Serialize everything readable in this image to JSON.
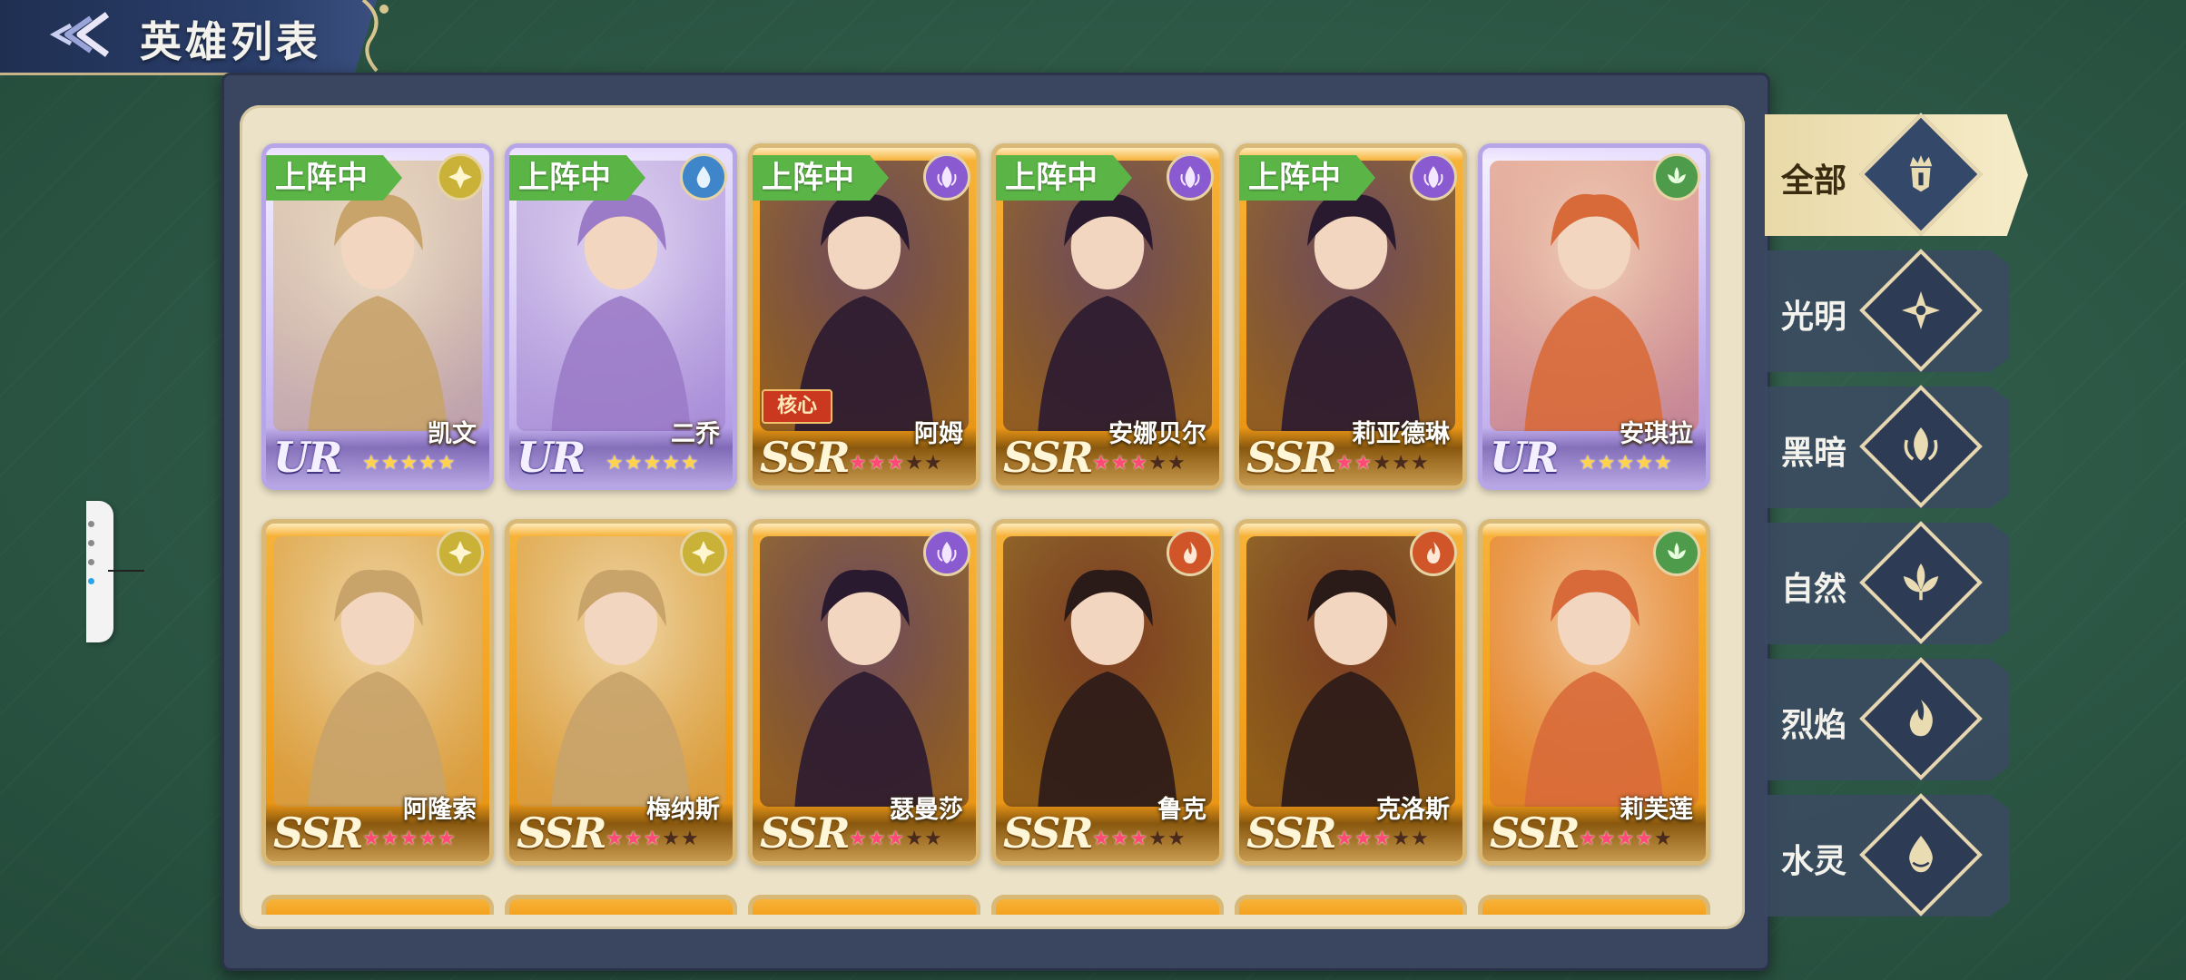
{
  "header": {
    "title": "英雄列表"
  },
  "filters": [
    {
      "label": "全部",
      "icon": "crown-helm-icon",
      "active": true
    },
    {
      "label": "光明",
      "icon": "light-star-icon",
      "active": false
    },
    {
      "label": "黑暗",
      "icon": "dark-flame-icon",
      "active": false
    },
    {
      "label": "自然",
      "icon": "leaf-icon",
      "active": false
    },
    {
      "label": "烈焰",
      "icon": "fire-icon",
      "active": false
    },
    {
      "label": "水灵",
      "icon": "water-drop-icon",
      "active": false
    }
  ],
  "badges": {
    "active": "上阵中",
    "core": "核心"
  },
  "heroes": [
    {
      "name": "凯文",
      "rarity": "UR",
      "element": "light",
      "active": true,
      "stars": 5,
      "max_stars": 5
    },
    {
      "name": "二乔",
      "rarity": "UR",
      "element": "water",
      "active": true,
      "stars": 5,
      "max_stars": 5
    },
    {
      "name": "阿姆",
      "rarity": "SSR",
      "element": "dark",
      "active": true,
      "core": true,
      "stars": 3,
      "max_stars": 5
    },
    {
      "name": "安娜贝尔",
      "rarity": "SSR",
      "element": "dark",
      "active": true,
      "stars": 3,
      "max_stars": 5
    },
    {
      "name": "莉亚德琳",
      "rarity": "SSR",
      "element": "dark",
      "active": true,
      "stars": 2,
      "max_stars": 5
    },
    {
      "name": "安琪拉",
      "rarity": "UR",
      "element": "nature",
      "active": false,
      "stars": 5,
      "max_stars": 5
    },
    {
      "name": "阿隆索",
      "rarity": "SSR",
      "element": "light",
      "active": false,
      "stars": 5,
      "max_stars": 5
    },
    {
      "name": "梅纳斯",
      "rarity": "SSR",
      "element": "light",
      "active": false,
      "stars": 3,
      "max_stars": 5
    },
    {
      "name": "瑟曼莎",
      "rarity": "SSR",
      "element": "dark",
      "active": false,
      "stars": 3,
      "max_stars": 5
    },
    {
      "name": "鲁克",
      "rarity": "SSR",
      "element": "fire",
      "active": false,
      "stars": 3,
      "max_stars": 5
    },
    {
      "name": "克洛斯",
      "rarity": "SSR",
      "element": "fire",
      "active": false,
      "stars": 3,
      "max_stars": 5
    },
    {
      "name": "莉芙莲",
      "rarity": "SSR",
      "element": "nature",
      "active": false,
      "stars": 4,
      "max_stars": 5
    }
  ],
  "colors": {
    "active_badge": "#5bb446",
    "ssr_card": "#f3a21d",
    "ur_card": "#b6a6e8",
    "panel": "#3a4660"
  }
}
